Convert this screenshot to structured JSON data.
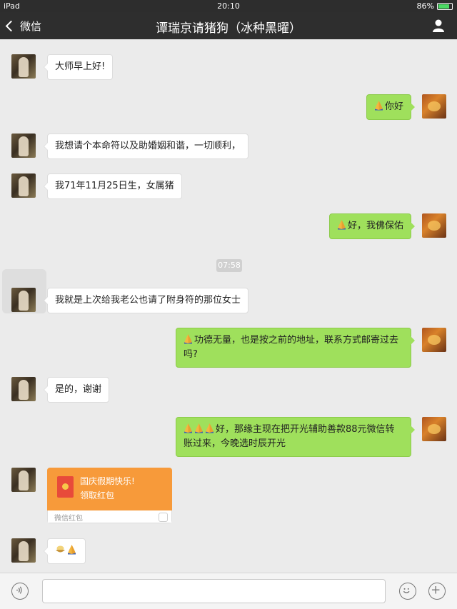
{
  "status_bar": {
    "device": "iPad",
    "time": "20:10",
    "battery": "86%"
  },
  "nav": {
    "back_label": "微信",
    "title": "谭瑞京请猪狗（冰种黑曜）"
  },
  "messages": [
    {
      "side": "in",
      "text": "大师早上好!"
    },
    {
      "side": "out",
      "emoji": [
        "pray"
      ],
      "text": "你好"
    },
    {
      "side": "in",
      "text": "我想请个本命符以及助婚姻和谐，一切顺利，"
    },
    {
      "side": "in",
      "text": "我71年11月25日生，女属猪"
    },
    {
      "side": "out",
      "emoji": [
        "pray"
      ],
      "text": "好，我佛保佑"
    },
    {
      "side": "in",
      "text": "我就是上次给我老公也请了附身符的那位女士"
    },
    {
      "side": "out",
      "emoji": [
        "pray"
      ],
      "text": "功德无量，也是按之前的地址，联系方式邮寄过去吗?"
    },
    {
      "side": "in",
      "text": "是的，谢谢"
    },
    {
      "side": "out",
      "emoji": [
        "pray",
        "pray",
        "pray"
      ],
      "text": "好，那缘主现在把开光辅助善款88元微信转账过来，今晚选时辰开光"
    },
    {
      "side": "in",
      "type": "red_packet"
    },
    {
      "side": "in",
      "emoji": [
        "bowl",
        "pray"
      ]
    }
  ],
  "timestamp": "07:58",
  "red_packet": {
    "greeting": "国庆假期快乐!",
    "action": "领取红包",
    "footer": "微信红包"
  },
  "input": {
    "placeholder": ""
  },
  "icons": {
    "voice": "voice-icon",
    "emoji": "emoji-smile-icon",
    "plus": "plus-icon",
    "person": "person-icon"
  },
  "colors": {
    "incoming_bubble": "#ffffff",
    "outgoing_bubble": "#9fe05c",
    "red_packet": "#f79a3a",
    "nav": "#2e2e2e"
  }
}
